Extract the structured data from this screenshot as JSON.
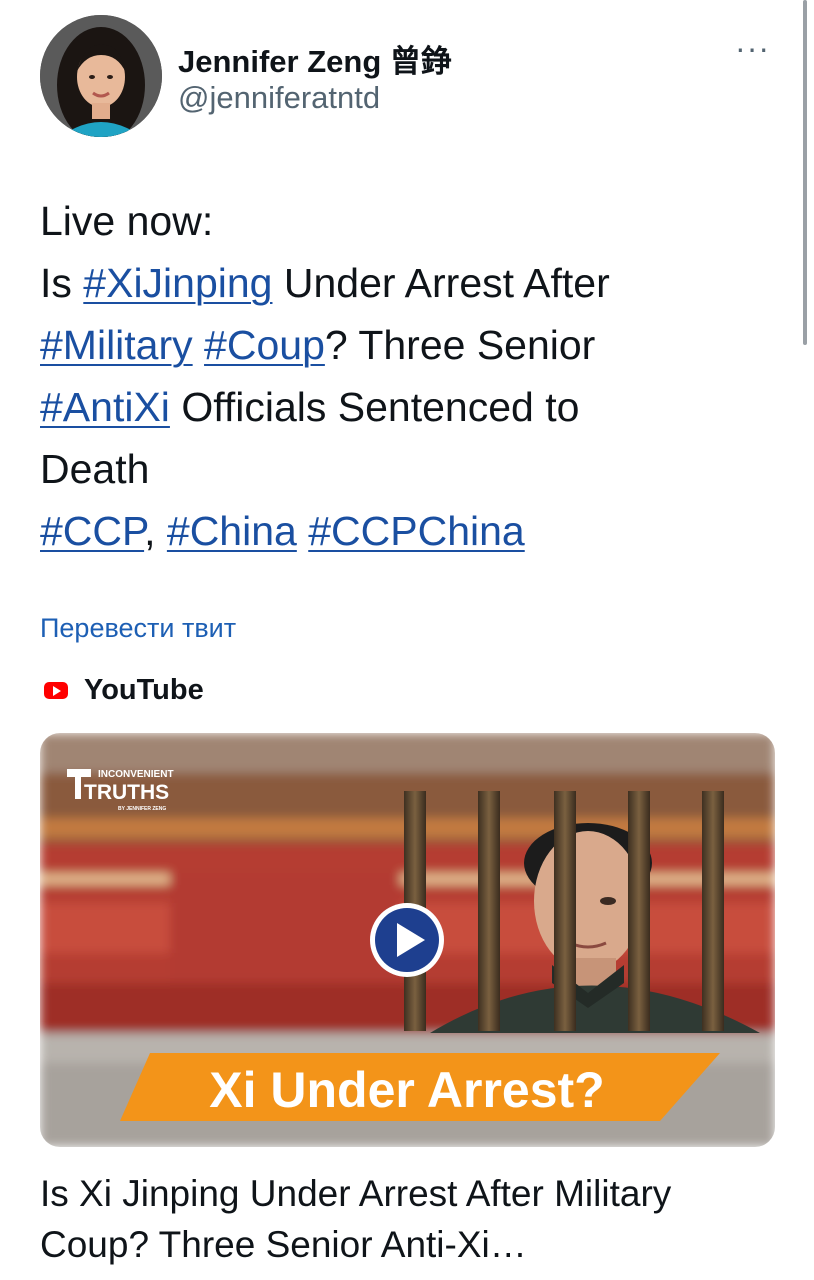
{
  "author": {
    "name": "Jennifer Zeng 曾錚",
    "handle": "@jenniferatntd"
  },
  "more_icon": "···",
  "tweet": {
    "lines": [
      [
        {
          "t": "Live now:"
        }
      ],
      [
        {
          "t": "Is "
        },
        {
          "t": "#XiJinping",
          "tag": true
        },
        {
          "t": " Under Arrest After"
        }
      ],
      [
        {
          "t": "#Military",
          "tag": true
        },
        {
          "t": " "
        },
        {
          "t": "#Coup",
          "tag": true
        },
        {
          "t": "? Three Senior"
        }
      ],
      [
        {
          "t": "#AntiXi",
          "tag": true
        },
        {
          "t": " Officials Sentenced to"
        }
      ],
      [
        {
          "t": "Death"
        }
      ],
      [
        {
          "t": "#CCP",
          "tag": true
        },
        {
          "t": ", "
        },
        {
          "t": "#China",
          "tag": true
        },
        {
          "t": " "
        },
        {
          "t": "#CCPChina",
          "tag": true
        }
      ]
    ]
  },
  "translate_label": "Перевести твит",
  "source": {
    "icon": "youtube-icon",
    "label": "YouTube"
  },
  "thumbnail": {
    "logo_top": "INCONVENIENT",
    "logo_main": "TRUTHS",
    "logo_sub": "BY JENNIFER ZENG",
    "banner": "Xi Under Arrest?",
    "play_icon": "play-icon"
  },
  "card_title_lines": [
    "Is Xi Jinping Under Arrest After Military",
    "Coup? Three Senior Anti-Xi…"
  ],
  "colors": {
    "hashtag": "#1a4fa1",
    "link": "#1d5fb4",
    "secondary": "#536471",
    "youtube_red": "#ff0000",
    "banner_orange": "#f39419",
    "play_blue": "#1e3f8f"
  }
}
